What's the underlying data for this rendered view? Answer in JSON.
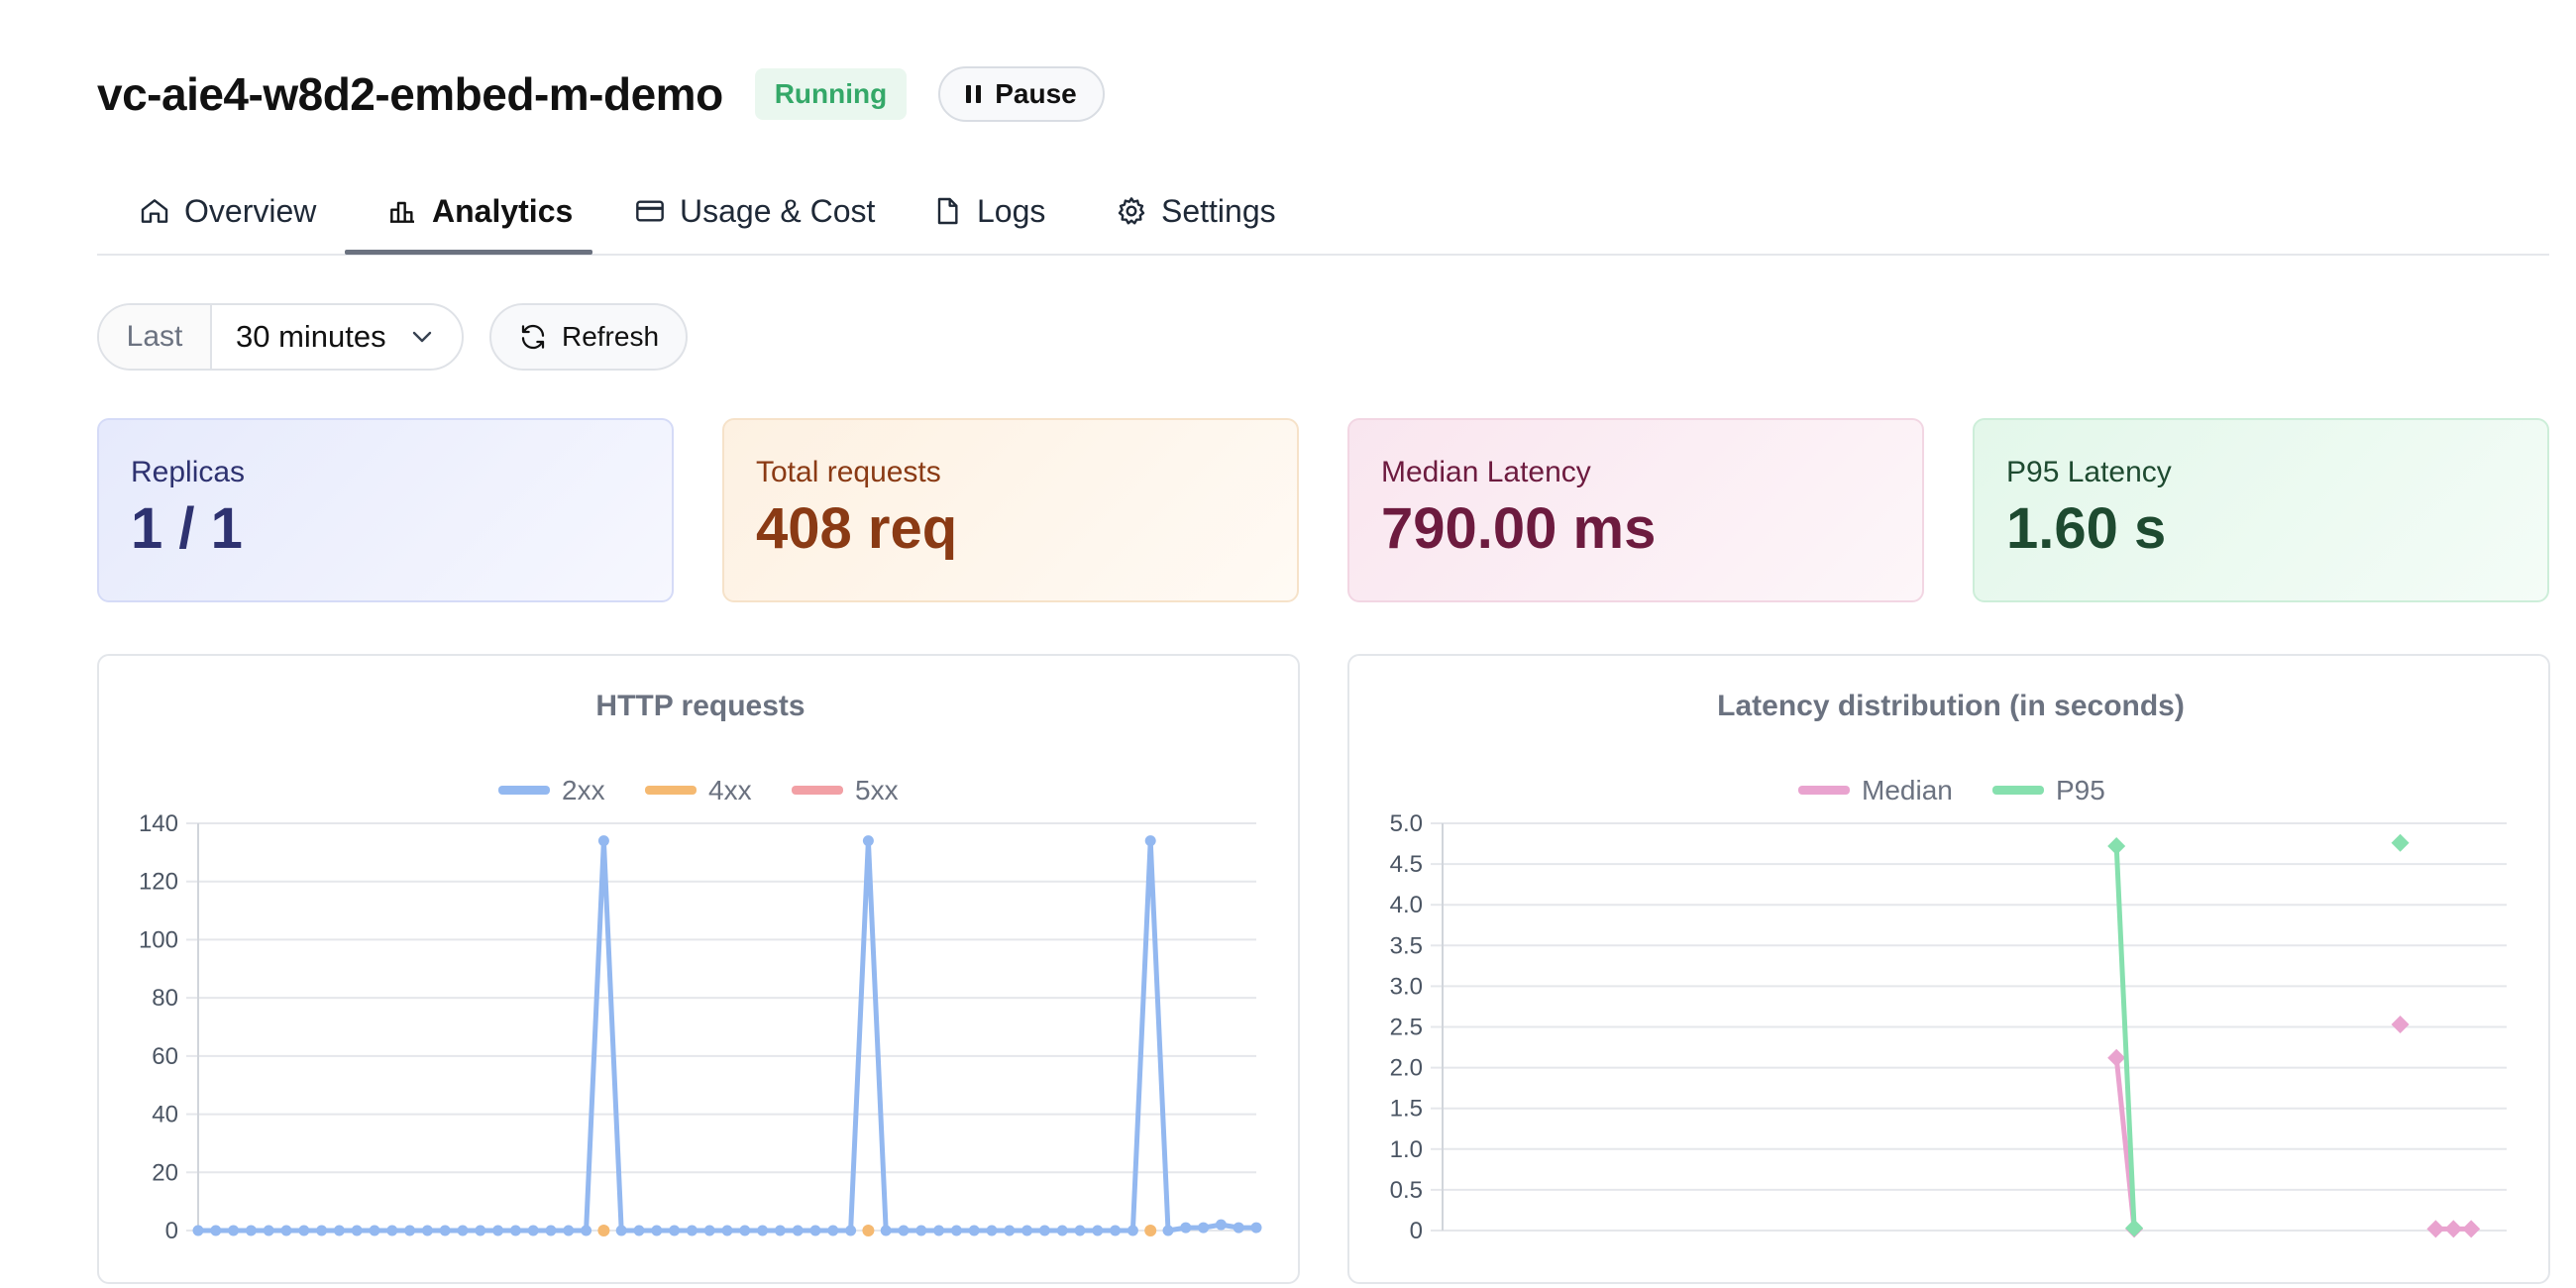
{
  "header": {
    "title": "vc-aie4-w8d2-embed-m-demo",
    "status": "Running",
    "pause_label": "Pause"
  },
  "tabs": [
    {
      "label": "Overview",
      "icon": "home-icon",
      "active": false
    },
    {
      "label": "Analytics",
      "icon": "bar-chart-icon",
      "active": true
    },
    {
      "label": "Usage & Cost",
      "icon": "credit-card-icon",
      "active": false
    },
    {
      "label": "Logs",
      "icon": "file-icon",
      "active": false
    },
    {
      "label": "Settings",
      "icon": "gear-icon",
      "active": false
    }
  ],
  "filters": {
    "time_label": "Last",
    "time_value": "30 minutes",
    "refresh_label": "Refresh"
  },
  "metrics": [
    {
      "label": "Replicas",
      "value": "1 / 1"
    },
    {
      "label": "Total requests",
      "value": "408 req"
    },
    {
      "label": "Median Latency",
      "value": "790.00 ms"
    },
    {
      "label": "P95 Latency",
      "value": "1.60 s"
    }
  ],
  "colors": {
    "series_2xx": "#93b8f0",
    "series_4xx": "#f5b971",
    "series_5xx": "#f2a0a5",
    "series_median": "#e9a3cf",
    "series_p95": "#86e0ae"
  },
  "chart_data": [
    {
      "type": "line",
      "title": "HTTP requests",
      "ylim": [
        0,
        140
      ],
      "yticks": [
        0,
        20,
        40,
        60,
        80,
        100,
        120,
        140
      ],
      "grid": true,
      "legend": "top-center",
      "x_count": 60,
      "series": [
        {
          "name": "2xx",
          "values": [
            0,
            0,
            0,
            0,
            0,
            0,
            0,
            0,
            0,
            0,
            0,
            0,
            0,
            0,
            0,
            0,
            0,
            0,
            0,
            0,
            0,
            0,
            0,
            134,
            0,
            0,
            0,
            0,
            0,
            0,
            0,
            0,
            0,
            0,
            0,
            0,
            0,
            0,
            134,
            0,
            0,
            0,
            0,
            0,
            0,
            0,
            0,
            0,
            0,
            0,
            0,
            0,
            0,
            0,
            134,
            0,
            1,
            1,
            2,
            1,
            1
          ]
        },
        {
          "name": "4xx",
          "values": [
            null,
            null,
            null,
            null,
            null,
            null,
            null,
            null,
            null,
            null,
            null,
            null,
            null,
            null,
            null,
            null,
            null,
            null,
            null,
            null,
            null,
            null,
            null,
            0,
            null,
            null,
            null,
            null,
            null,
            null,
            null,
            null,
            null,
            null,
            null,
            null,
            null,
            null,
            0,
            null,
            null,
            null,
            null,
            null,
            null,
            null,
            null,
            null,
            null,
            null,
            null,
            null,
            null,
            null,
            0,
            null,
            null,
            null,
            null,
            null,
            null
          ]
        },
        {
          "name": "5xx",
          "values": []
        }
      ]
    },
    {
      "type": "line",
      "title": "Latency distribution (in seconds)",
      "ylim": [
        0,
        5
      ],
      "yticks": [
        "0",
        "0.5",
        "1.0",
        "1.5",
        "2.0",
        "2.5",
        "3.0",
        "3.5",
        "4.0",
        "4.5",
        "5.0"
      ],
      "grid": true,
      "legend": "top-center",
      "x_count": 60,
      "series": [
        {
          "name": "Median",
          "points": [
            [
              38,
              2.12
            ],
            [
              39,
              0.02
            ],
            [
              54,
              2.53
            ],
            [
              56,
              0.02
            ],
            [
              57,
              0.02
            ],
            [
              58,
              0.02
            ]
          ]
        },
        {
          "name": "P95",
          "points": [
            [
              38,
              4.72
            ],
            [
              39,
              0.03
            ],
            [
              54,
              4.76
            ]
          ]
        }
      ]
    }
  ]
}
